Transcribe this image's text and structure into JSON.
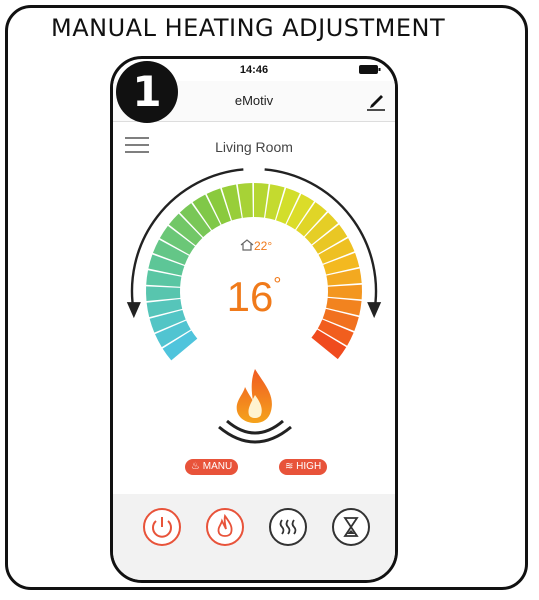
{
  "card": {
    "title": "MANUAL HEATING ADJUSTMENT",
    "step_number": "1"
  },
  "status_bar": {
    "time": "14:46"
  },
  "nav": {
    "title": "eMotiv",
    "edit_icon": "edit-pencil-icon"
  },
  "room": {
    "name": "Living Room",
    "menu_icon": "hamburger-menu-icon"
  },
  "thermostat": {
    "current_temp": "16",
    "degree_symbol": "°",
    "target_temp": "22°",
    "home_icon": "home-icon",
    "flame_icon": "flame-icon",
    "adjust_arrows": [
      "rotate-left-arrow-icon",
      "rotate-right-arrow-icon"
    ]
  },
  "modes": {
    "manual_label": "MANU",
    "manual_icon": "flame-icon",
    "power_label": "HIGH",
    "power_icon": "heat-waves-icon"
  },
  "colors": {
    "accent": "#e8533a",
    "temp_text": "#f07a1a",
    "gradient_start": "#4fc4dc",
    "gradient_mid": "#84c83e",
    "gradient_end": "#f04b1e"
  },
  "bottom_bar": {
    "buttons": [
      {
        "icon": "power-icon"
      },
      {
        "icon": "flame-icon"
      },
      {
        "icon": "heat-waves-icon"
      },
      {
        "icon": "hourglass-icon"
      }
    ]
  }
}
